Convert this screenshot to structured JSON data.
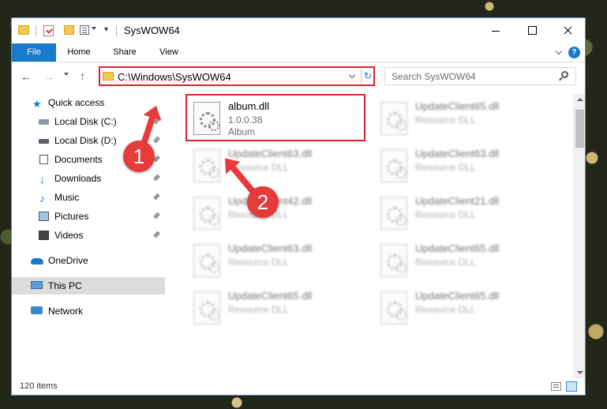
{
  "window": {
    "title": "SysWOW64"
  },
  "ribbon": {
    "file": "File",
    "home": "Home",
    "share": "Share",
    "view": "View",
    "help_icon": "?"
  },
  "address": {
    "path": "C:\\Windows\\SysWOW64",
    "search_placeholder": "Search SysWOW64"
  },
  "sidebar": {
    "items": [
      {
        "label": "Quick access",
        "icon": "star-icon"
      },
      {
        "label": "Local Disk (C:)",
        "icon": "disk-icon"
      },
      {
        "label": "Local Disk (D:)",
        "icon": "disk-icon"
      },
      {
        "label": "Documents",
        "icon": "document-icon"
      },
      {
        "label": "Downloads",
        "icon": "download-icon"
      },
      {
        "label": "Music",
        "icon": "music-icon"
      },
      {
        "label": "Pictures",
        "icon": "pictures-icon"
      },
      {
        "label": "Videos",
        "icon": "video-icon"
      },
      {
        "label": "OneDrive",
        "icon": "cloud-icon"
      },
      {
        "label": "This PC",
        "icon": "computer-icon"
      },
      {
        "label": "Network",
        "icon": "network-icon"
      }
    ]
  },
  "files": [
    {
      "name": "album.dll",
      "line2": "1.0.0.38",
      "line3": "Album"
    },
    {
      "name": "UpdateClient65.dll",
      "line2": "Resource DLL"
    },
    {
      "name": "UpdateClient63.dll",
      "line2": "Resource DLL"
    },
    {
      "name": "UpdateClient63.dll",
      "line2": "Resource DLL"
    },
    {
      "name": "UpdateClient42.dll",
      "line2": "Resource DLL"
    },
    {
      "name": "UpdateClient21.dll",
      "line2": "Resource DLL"
    },
    {
      "name": "UpdateClient63.dll",
      "line2": "Resource DLL"
    },
    {
      "name": "UpdateClient65.dll",
      "line2": "Resource DLL"
    },
    {
      "name": "UpdateClient65.dll",
      "line2": "Resource DLL"
    },
    {
      "name": "UpdateClient65.dll",
      "line2": "Resource DLL"
    }
  ],
  "status": {
    "count": "120 items"
  },
  "annotations": {
    "step1": "1",
    "step2": "2"
  },
  "colors": {
    "accent": "#1979ca",
    "highlight": "#d7262a",
    "annotation": "#e63b3b"
  }
}
